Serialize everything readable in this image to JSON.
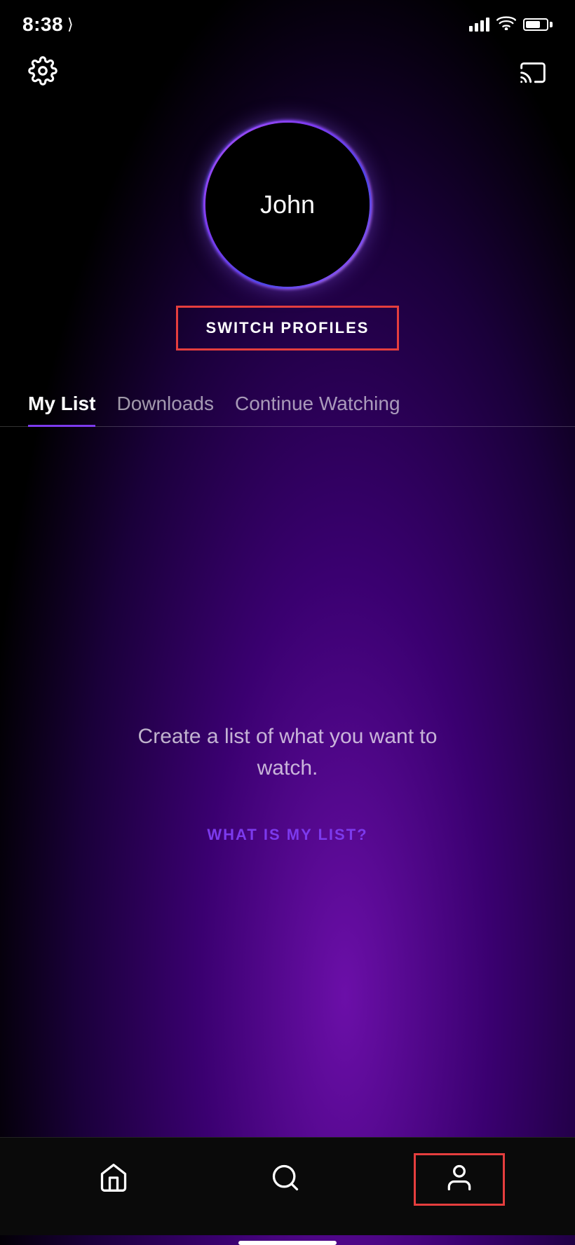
{
  "statusBar": {
    "time": "8:38",
    "locationIcon": "▶"
  },
  "topBar": {
    "settingsLabel": "Settings",
    "castLabel": "Cast"
  },
  "profile": {
    "name": "John",
    "switchButtonLabel": "SWITCH PROFILES"
  },
  "tabs": [
    {
      "id": "my-list",
      "label": "My List",
      "active": true
    },
    {
      "id": "downloads",
      "label": "Downloads",
      "active": false
    },
    {
      "id": "continue-watching",
      "label": "Continue Watching",
      "active": false
    }
  ],
  "myList": {
    "emptyMessage": "Create a list of what you want to watch.",
    "whatIsLink": "WHAT IS MY LIST?"
  },
  "bottomNav": [
    {
      "id": "home",
      "label": "Home",
      "icon": "home"
    },
    {
      "id": "search",
      "label": "Search",
      "icon": "search"
    },
    {
      "id": "profile",
      "label": "Profile",
      "icon": "profile",
      "active": true
    }
  ],
  "colors": {
    "accent": "#7c3aed",
    "highlight": "#e53e3e",
    "profileBorderStart": "#a855f7",
    "profileBorderEnd": "#4f46e5"
  }
}
